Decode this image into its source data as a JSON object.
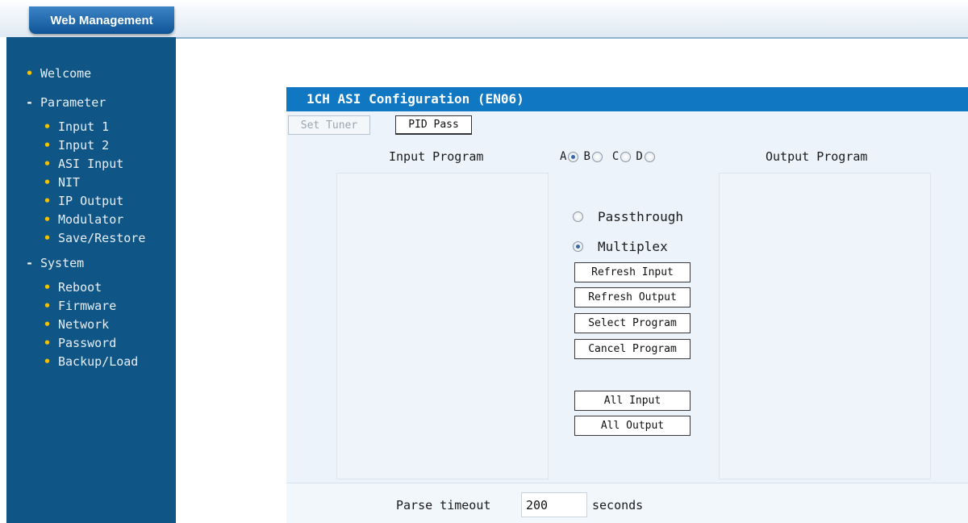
{
  "header": {
    "tab_label": "Web Management"
  },
  "sidebar": {
    "items": [
      {
        "label": "Welcome",
        "marker": "•"
      },
      {
        "label": "Parameter",
        "marker": "-"
      },
      {
        "label": "Input 1",
        "marker": "•"
      },
      {
        "label": "Input 2",
        "marker": "•"
      },
      {
        "label": "ASI Input",
        "marker": "•"
      },
      {
        "label": "NIT",
        "marker": "•"
      },
      {
        "label": "IP Output",
        "marker": "•"
      },
      {
        "label": "Modulator",
        "marker": "•"
      },
      {
        "label": "Save/Restore",
        "marker": "•"
      },
      {
        "label": "System",
        "marker": "-"
      },
      {
        "label": "Reboot",
        "marker": "•"
      },
      {
        "label": "Firmware",
        "marker": "•"
      },
      {
        "label": "Network",
        "marker": "•"
      },
      {
        "label": "Password",
        "marker": "•"
      },
      {
        "label": "Backup/Load",
        "marker": "•"
      }
    ]
  },
  "panel": {
    "title": "1CH ASI Configuration (EN06)",
    "tabs": {
      "set_tuner": "Set Tuner",
      "pid_pass": "PID Pass"
    },
    "input_program_label": "Input Program",
    "output_program_label": "Output Program",
    "channels": [
      {
        "letter": "A",
        "selected": true
      },
      {
        "letter": "B",
        "selected": false
      },
      {
        "letter": "C",
        "selected": false
      },
      {
        "letter": "D",
        "selected": false
      }
    ],
    "modes": {
      "passthrough": "Passthrough",
      "multiplex": "Multiplex",
      "selected": "Multiplex"
    },
    "buttons": {
      "refresh_input": "Refresh Input",
      "refresh_output": "Refresh Output",
      "select_program": "Select Program",
      "cancel_program": "Cancel Program",
      "all_input": "All Input",
      "all_output": "All Output"
    },
    "parse_timeout": {
      "label": "Parse timeout",
      "value": "200",
      "unit": "seconds"
    }
  },
  "colors": {
    "sidebar": "#0f5687",
    "title_bar": "#1077c2",
    "panel_bg": "#ecf3fa",
    "bullet": "#f2c200"
  }
}
